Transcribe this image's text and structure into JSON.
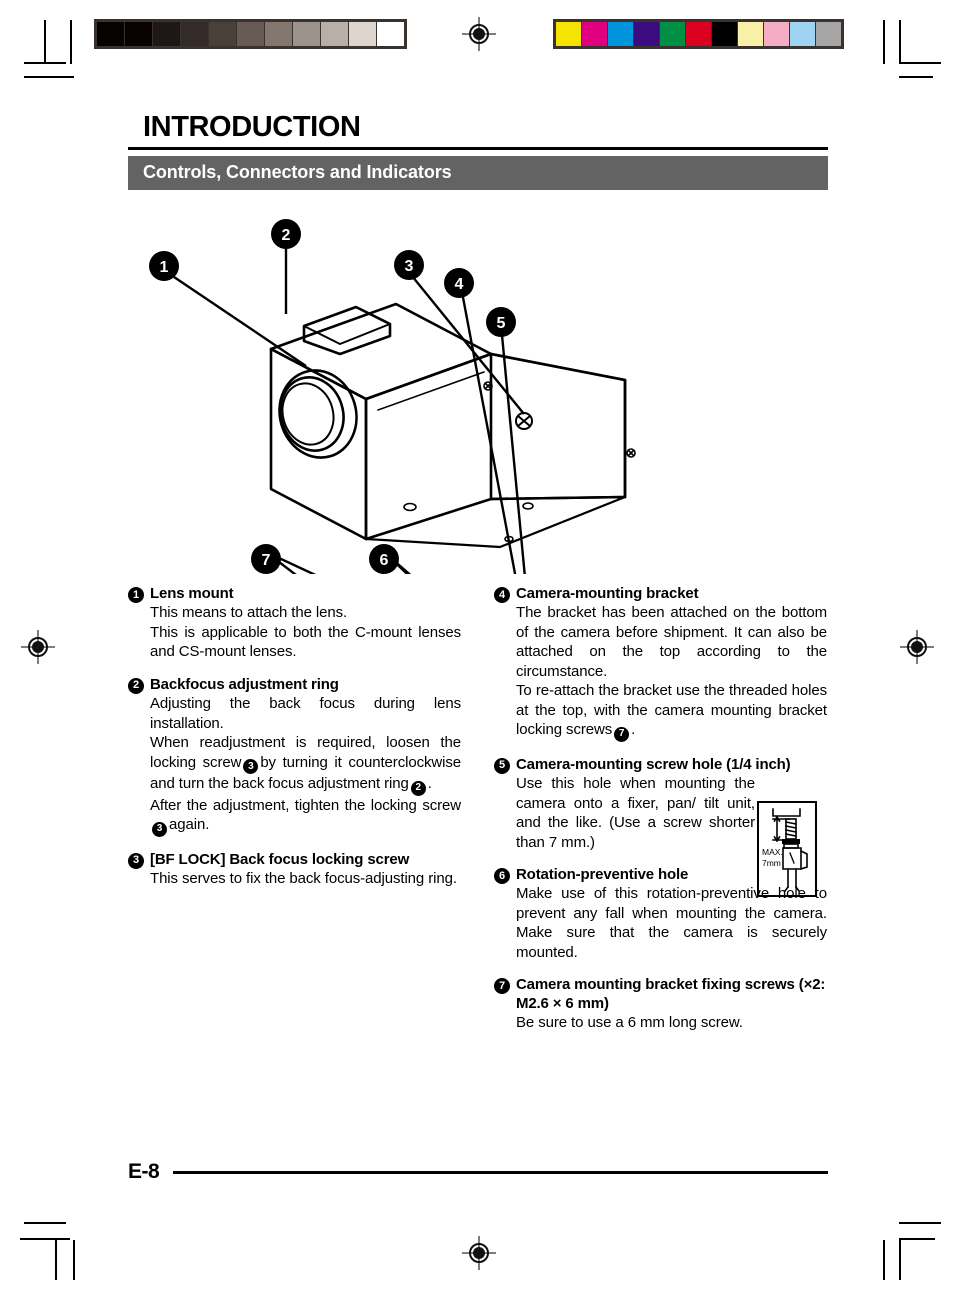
{
  "calibration": {
    "gray_scale_label": "grayscale-calibration-strip",
    "gray_swatches": [
      "#050203",
      "#070102",
      "#1d1715",
      "#332b27",
      "#49403a",
      "#665c55",
      "#827870",
      "#9c938c",
      "#b8afa9",
      "#dcd6cf",
      "#ffffff"
    ],
    "color_swatches": [
      "#f5e400",
      "#e0007f",
      "#0094dd",
      "#3b0b7f",
      "#009045",
      "#dc0020",
      "#000000",
      "#f9f0a8",
      "#f5adc5",
      "#9ed4f2",
      "#a5a5a5"
    ]
  },
  "header": {
    "title": "INTRODUCTION",
    "section": "Controls, Connectors and Indicators"
  },
  "figure": {
    "alt": "Isometric line drawing of a box camera with numbered callouts",
    "callouts": [
      {
        "n": "1",
        "label": "lens-mount"
      },
      {
        "n": "2",
        "label": "backfocus-adjustment-ring"
      },
      {
        "n": "3",
        "label": "back-focus-locking-screw"
      },
      {
        "n": "4",
        "label": "camera-mounting-bracket"
      },
      {
        "n": "5",
        "label": "camera-mounting-screw-hole"
      },
      {
        "n": "6",
        "label": "rotation-preventive-hole"
      },
      {
        "n": "7",
        "label": "camera-mounting-bracket-fixing-screws"
      }
    ]
  },
  "left_column": {
    "items": [
      {
        "num": "1",
        "title": "Lens mount",
        "paragraphs": [
          "This means to attach the lens.",
          "This is applicable to both the C-mount lenses and CS-mount lenses."
        ]
      },
      {
        "num": "2",
        "title": "Backfocus adjustment ring",
        "paragraphs": [
          "Adjusting the back focus during lens installation."
        ],
        "rich": {
          "line_a_pre": "When readjustment is required, loosen the locking screw",
          "badge_a": "3",
          "line_a_mid": "by turning it counterclockwise and turn the back focus adjustment ring",
          "badge_b": "2",
          "line_a_post": ".",
          "line_b_pre": "After the adjustment, tighten the locking screw",
          "badge_c": "3",
          "line_b_post": "again."
        }
      },
      {
        "num": "3",
        "title": "[BF LOCK] Back focus locking screw",
        "paragraphs": [
          "This serves to fix the back focus-adjusting ring."
        ]
      }
    ]
  },
  "right_column": {
    "items": [
      {
        "num": "4",
        "title": "Camera-mounting bracket",
        "paragraphs": [
          "The bracket has been attached on the bottom of the camera before shipment. It can also be attached on the top according to the circumstance."
        ],
        "rich": {
          "line_pre": "To re-attach the bracket use the threaded holes at the top, with the camera mounting bracket locking screws",
          "badge": "7",
          "line_post": "."
        }
      },
      {
        "num": "5",
        "title": "Camera-mounting screw hole (1/4 inch)",
        "paragraphs": [
          "Use this hole when mounting the camera onto a fixer, pan/ tilt unit, and the like.  (Use a screw shorter than 7 mm.)"
        ],
        "inset": {
          "name": "screw-length-diagram",
          "label_line1": "MAX.",
          "label_line2": "7mm"
        }
      },
      {
        "num": "6",
        "title": "Rotation-preventive hole",
        "paragraphs": [
          "Make use of this rotation-preventive hole to prevent any fall when mounting the camera.  Make sure that the camera is securely mounted."
        ]
      },
      {
        "num": "7",
        "title": "Camera mounting bracket fixing screws",
        "title_line2": "(×2: M2.6 × 6 mm)",
        "paragraphs": [
          "Be sure to use a 6 mm long screw."
        ]
      }
    ]
  },
  "footer": {
    "page_number": "E-8"
  }
}
